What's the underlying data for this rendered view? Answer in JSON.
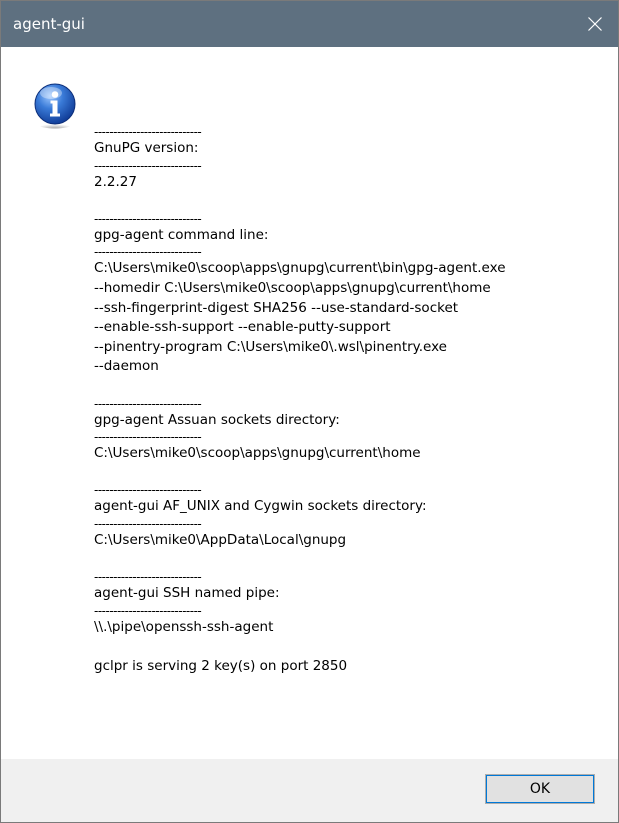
{
  "window": {
    "title": "agent-gui",
    "close_icon": "close-icon",
    "titlebar_color": "#5e7080"
  },
  "dialog": {
    "icon": "info-icon",
    "separator": "----------------------------",
    "sections": [
      {
        "heading": "GnuPG version:",
        "values": [
          "2.2.27"
        ]
      },
      {
        "heading": "gpg-agent command line:",
        "values": [
          "C:\\Users\\mike0\\scoop\\apps\\gnupg\\current\\bin\\gpg-agent.exe",
          "--homedir C:\\Users\\mike0\\scoop\\apps\\gnupg\\current\\home",
          "--ssh-fingerprint-digest SHA256 --use-standard-socket",
          "--enable-ssh-support --enable-putty-support",
          "--pinentry-program C:\\Users\\mike0\\.wsl\\pinentry.exe",
          "--daemon"
        ]
      },
      {
        "heading": "gpg-agent Assuan sockets directory:",
        "values": [
          "C:\\Users\\mike0\\scoop\\apps\\gnupg\\current\\home"
        ]
      },
      {
        "heading": "agent-gui AF_UNIX and Cygwin sockets directory:",
        "values": [
          "C:\\Users\\mike0\\AppData\\Local\\gnupg"
        ]
      },
      {
        "heading": "agent-gui SSH named pipe:",
        "values": [
          "\\\\.\\pipe\\openssh-ssh-agent"
        ]
      }
    ],
    "footer_text": "gclpr is serving 2 key(s) on port 2850"
  },
  "buttons": {
    "ok_label": "OK"
  }
}
